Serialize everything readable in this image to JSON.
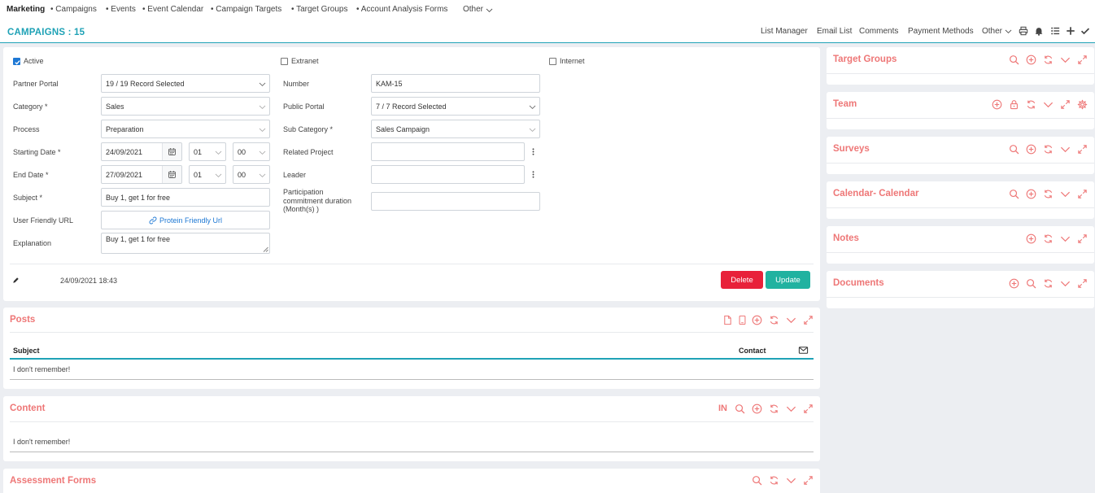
{
  "topnav": {
    "items": [
      "Marketing",
      "• Campaigns",
      "• Events",
      "• Event Calendar",
      "• Campaign Targets",
      "• Target Groups",
      "• Account Analysis Forms",
      "Other"
    ]
  },
  "header": {
    "title": "CAMPAIGNS : 15",
    "links": [
      "List Manager",
      "Email List",
      "Comments",
      "Payment Methods",
      "Other"
    ]
  },
  "form": {
    "active_label": "Active",
    "extranet_label": "Extranet",
    "internet_label": "Internet",
    "labels": {
      "partner_portal": "Partner Portal",
      "category": "Category *",
      "process": "Process",
      "starting_date": "Starting Date *",
      "end_date": "End Date *",
      "subject": "Subject *",
      "user_friendly_url": "User Friendly URL",
      "explanation": "Explanation",
      "number": "Number",
      "public_portal": "Public Portal",
      "sub_category": "Sub Category *",
      "related_project": "Related Project",
      "leader": "Leader",
      "participation": "Participation commitment duration (Month(s) )"
    },
    "values": {
      "partner_portal": "19 / 19 Record Selected",
      "category": "Sales",
      "process": "Preparation",
      "start_date": "24/09/2021",
      "start_hour": "01",
      "start_min": "00",
      "end_date": "27/09/2021",
      "end_hour": "01",
      "end_min": "00",
      "subject": "Buy 1, get 1 for free",
      "url_link": "Protein Friendly Url",
      "explanation": "Buy 1, get 1 for free",
      "number": "KAM-15",
      "public_portal": "7 / 7 Record Selected",
      "sub_category": "Sales Campaign",
      "related_project": "",
      "leader": "",
      "participation": ""
    },
    "timestamp": "24/09/2021 18:43",
    "delete_label": "Delete",
    "update_label": "Update"
  },
  "posts": {
    "title": "Posts",
    "col_subject": "Subject",
    "col_contact": "Contact",
    "row1": "I don't remember!"
  },
  "content": {
    "title": "Content",
    "badge": "IN",
    "row1": "I don't remember!"
  },
  "assessment": {
    "title": "Assessment Forms"
  },
  "side": {
    "target_groups": "Target Groups",
    "team": "Team",
    "surveys": "Surveys",
    "calendar": "Calendar- Calendar",
    "notes": "Notes",
    "documents": "Documents"
  },
  "colors": {
    "accent": "#1fa2b6",
    "panel_title": "#ee7777",
    "delete": "#e8213a",
    "update": "#20b2a0"
  }
}
